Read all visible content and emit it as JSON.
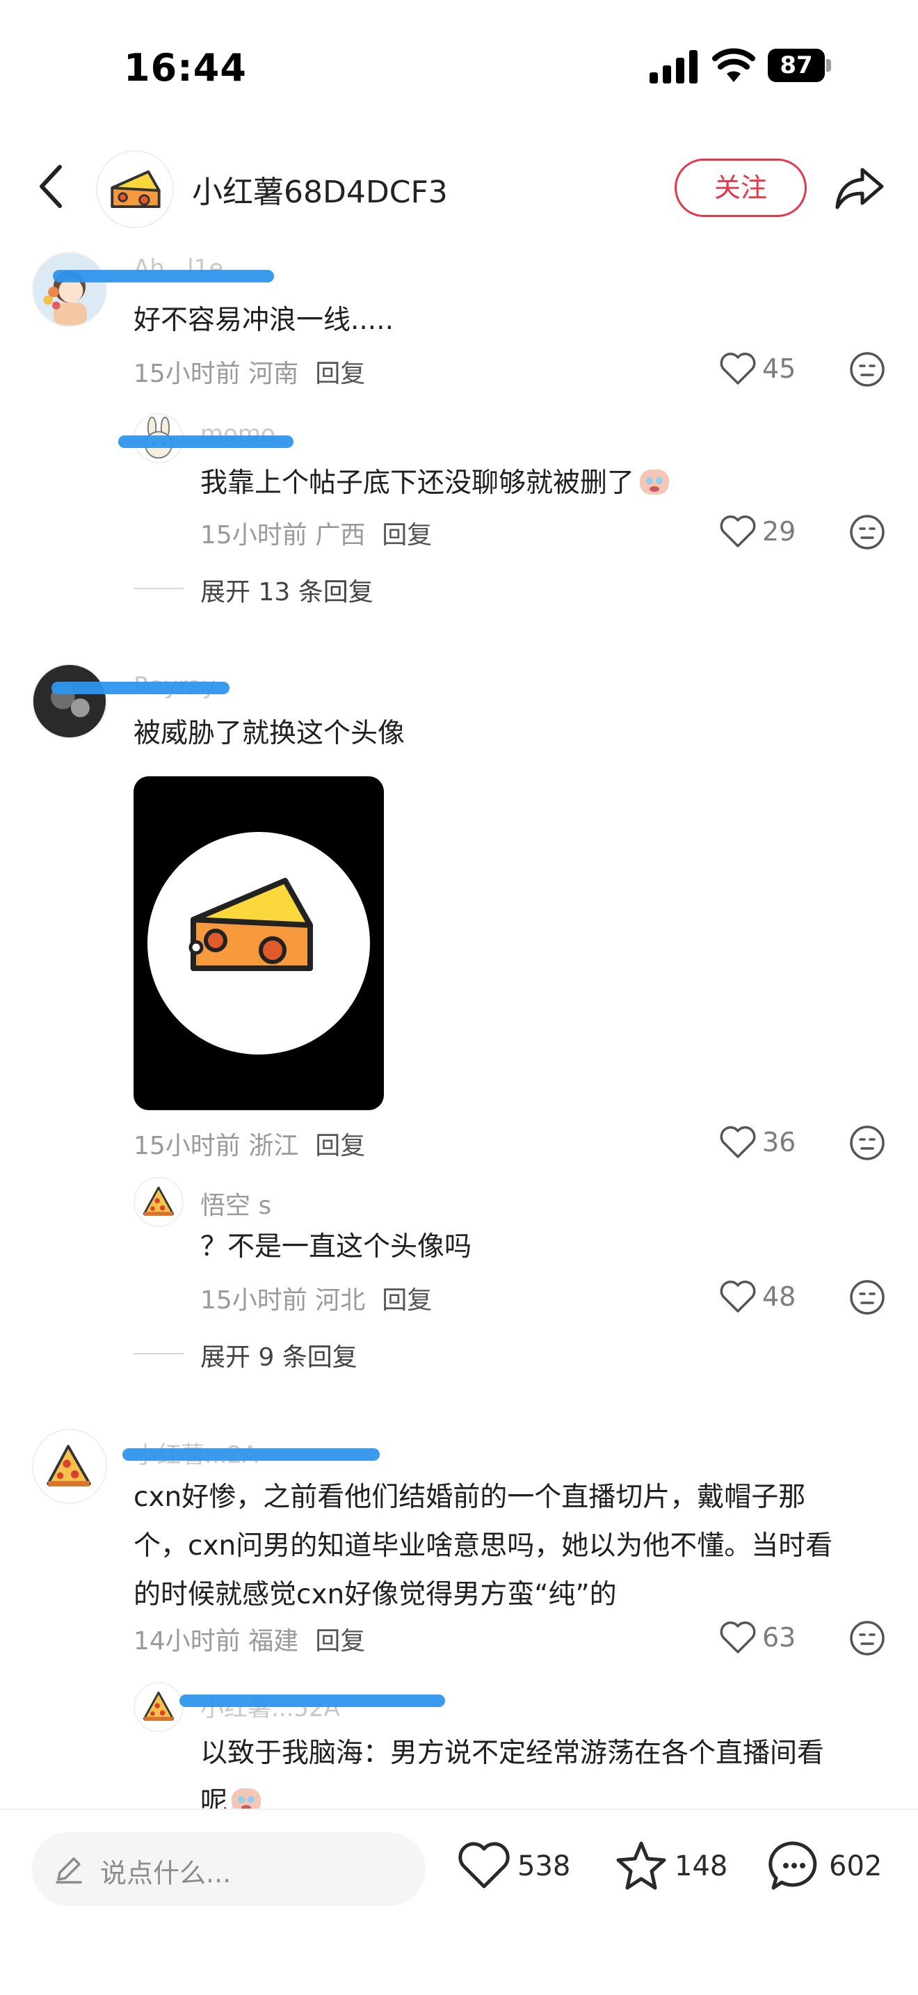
{
  "status_bar": {
    "time": "16:44",
    "battery": "87"
  },
  "header": {
    "title": "小红薯68D4DCF3",
    "follow_label": "关注"
  },
  "comments": [
    {
      "name_hidden": "Ah...l1e",
      "text": "好不容易冲浪一线.....",
      "time": "15小时前",
      "location": "河南",
      "reply_label": "回复",
      "likes": "45",
      "replies": [
        {
          "name_hidden": "momo",
          "text": "我靠上个帖子底下还没聊够就被删了",
          "time": "15小时前",
          "location": "广西",
          "reply_label": "回复",
          "likes": "29"
        }
      ],
      "expand_label": "展开 13 条回复"
    },
    {
      "name_hidden": "Rayray",
      "text": "被威胁了就换这个头像",
      "time": "15小时前",
      "location": "浙江",
      "reply_label": "回复",
      "likes": "36",
      "replies": [
        {
          "name": "悟空 s",
          "text": "？不是一直这个头像吗",
          "time": "15小时前",
          "location": "河北",
          "reply_label": "回复",
          "likes": "48"
        }
      ],
      "expand_label": "展开 9 条回复"
    },
    {
      "name_hidden": "小红薯...2A",
      "text_lines": [
        "cxn好惨，之前看他们结婚前的一个直播切片，戴帽子那",
        "个，cxn问男的知道毕业啥意思吗，她以为他不懂。当时看",
        "的时候就感觉cxn好像觉得男方蛮“纯”的"
      ],
      "time": "14小时前",
      "location": "福建",
      "reply_label": "回复",
      "likes": "63",
      "replies": [
        {
          "name_hidden": "小红薯...52A",
          "text_lines": [
            "以致于我脑海：男方说不定经常游荡在各个直播间看",
            "呢"
          ]
        }
      ]
    }
  ],
  "bottom_bar": {
    "input_placeholder": "说点什么...",
    "likes": "538",
    "favorites": "148",
    "comments": "602"
  },
  "colors": {
    "accent_red": "#e4374a",
    "redaction_blue": "#2f95ec"
  },
  "icons": [
    "back-icon",
    "share-icon",
    "heart-icon",
    "neutral-face-icon",
    "star-icon",
    "chat-bubble-icon",
    "pencil-icon"
  ]
}
